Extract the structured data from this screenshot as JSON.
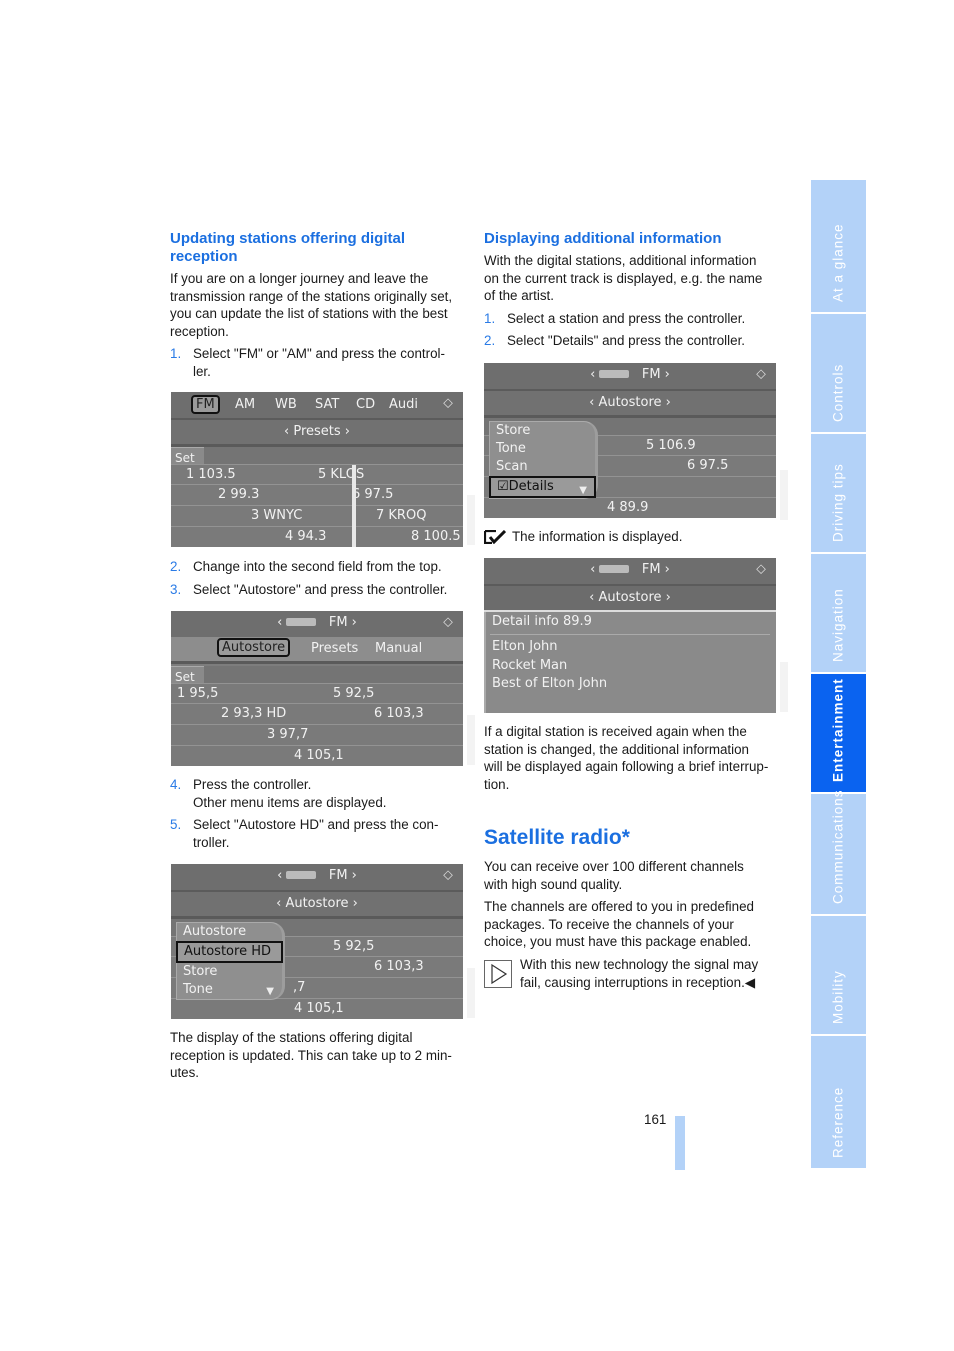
{
  "left_column": {
    "heading": "Updating stations offering digital reception",
    "heading_line1": "Updating stations offering digital",
    "heading_line2": "reception",
    "intro": [
      "If you are on a longer journey and leave the",
      "transmission range of the stations originally set,",
      "you can update the list of stations with the best",
      "reception."
    ],
    "step1": {
      "num": "1.",
      "lines": [
        "Select \"FM\" or \"AM\" and press the control-",
        "ler."
      ]
    },
    "screen1": {
      "tabs": [
        "FM",
        "AM",
        "WB",
        "SAT",
        "CD",
        "Audi"
      ],
      "selected_tab": "FM",
      "submenu": "Presets",
      "set_label": "Set",
      "stations": [
        "1 103.5",
        "2 99.3",
        "3 WNYC",
        "4 94.3",
        "5 KLOS",
        "6 97.5",
        "7 KROQ",
        "8 100.5"
      ]
    },
    "step2": {
      "num": "2.",
      "text": "Change into the second field from the top."
    },
    "step3": {
      "num": "3.",
      "text": "Select \"Autostore\" and press the controller."
    },
    "screen2": {
      "band": "FM",
      "tabs": [
        "Autostore",
        "Presets",
        "Manual"
      ],
      "selected_tab": "Autostore",
      "set_label": "Set",
      "stations": [
        "1 95,5",
        "2 93,3 HD",
        "3 97,7",
        "4 105,1",
        "5 92,5",
        "6 103,3"
      ]
    },
    "step4": {
      "num": "4.",
      "lines": [
        "Press the controller.",
        "Other menu items are displayed."
      ]
    },
    "step5": {
      "num": "5.",
      "lines": [
        "Select \"Autostore HD\" and press the con-",
        "troller."
      ]
    },
    "screen3": {
      "band": "FM",
      "submenu": "Autostore",
      "menu_items": [
        "Autostore",
        "Autostore HD",
        "Store",
        "Tone"
      ],
      "selected_item": "Autostore HD",
      "stations": [
        "5 92,5",
        "6 103,3",
        ",7",
        "4 105,1"
      ]
    },
    "outro": [
      "The display of the stations offering digital",
      "reception is updated. This can take up to 2 min-",
      "utes."
    ]
  },
  "right_column": {
    "heading": "Displaying additional information",
    "intro": [
      "With the digital stations, additional information",
      "on the current track is displayed, e.g. the name",
      "of the artist."
    ],
    "step1": {
      "num": "1.",
      "text": "Select a station and press the controller."
    },
    "step2": {
      "num": "2.",
      "text": "Select \"Details\" and press the controller."
    },
    "screen4": {
      "band": "FM",
      "submenu": "Autostore",
      "menu_items": [
        "Store",
        "Tone",
        "Scan",
        "Details"
      ],
      "selected_item": "Details",
      "stations": [
        "5 106.9",
        "6 97.5",
        "4 89.9"
      ]
    },
    "info_note": "The information is displayed.",
    "screen5": {
      "band": "FM",
      "submenu": "Autostore",
      "detail_title": "Detail info 89.9",
      "detail_lines": [
        "Elton John",
        "Rocket Man",
        "Best of Elton John"
      ]
    },
    "reception_note": [
      "If a digital station is received again when the",
      "station is changed, the additional information",
      "will be displayed again following a brief interrup-",
      "tion."
    ],
    "section_title": "Satellite radio*",
    "sat_p1": [
      "You can receive over 100 different channels",
      "with high sound quality."
    ],
    "sat_p2": [
      "The channels are offered to you in predefined",
      "packages. To receive the channels of your",
      "choice, you must have this package enabled."
    ],
    "sat_note": [
      "With this new technology the signal may",
      "fail, causing interruptions in reception.◀"
    ]
  },
  "page_number": "161",
  "side_tabs": [
    {
      "label": "At a glance",
      "active": false
    },
    {
      "label": "Controls",
      "active": false
    },
    {
      "label": "Driving tips",
      "active": false
    },
    {
      "label": "Navigation",
      "active": false
    },
    {
      "label": "Entertainment",
      "active": true
    },
    {
      "label": "Communications",
      "active": false
    },
    {
      "label": "Mobility",
      "active": false
    },
    {
      "label": "Reference",
      "active": false
    }
  ],
  "colors": {
    "accent": "#1b6fe0",
    "tab_inactive": "#b3d2f8",
    "tab_active": "#0a63f0"
  }
}
